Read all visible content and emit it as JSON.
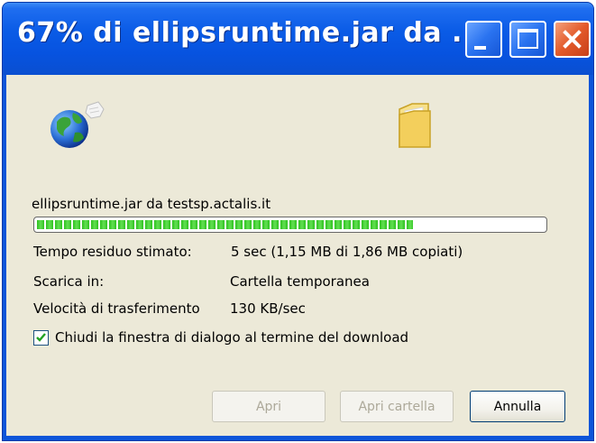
{
  "window": {
    "title": "67% di ellipsruntime.jar da ...",
    "title_bar_color": "#0a5be6",
    "close_color": "#e35a2a"
  },
  "download": {
    "file_line": "ellipsruntime.jar da testsp.actalis.it",
    "progress_fraction": 0.742,
    "progress_color": "#2ec11f",
    "time_label": "Tempo residuo stimato:",
    "time_value": "5 sec (1,15 MB di 1,86 MB copiati)",
    "dest_label": "Scarica in:",
    "dest_value": "Cartella temporanea",
    "speed_label": "Velocità di trasferimento",
    "speed_value": "130 KB/sec"
  },
  "checkbox": {
    "label": "Chiudi la finestra di dialogo al termine del download",
    "checked": true
  },
  "buttons": {
    "open": "Apri",
    "open_folder": "Apri cartella",
    "cancel": "Annulla"
  },
  "icons": {
    "source": "globe-icon",
    "destination": "folder-icon"
  }
}
